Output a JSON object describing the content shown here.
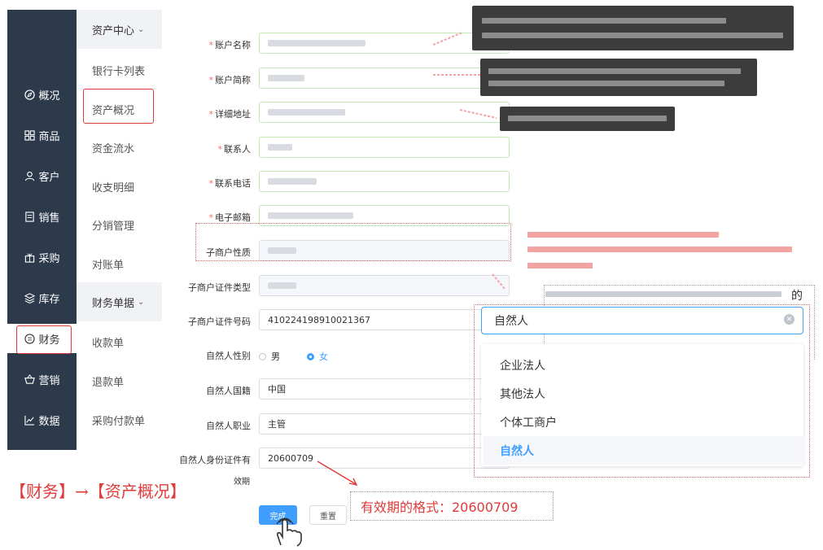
{
  "nav": {
    "items": [
      {
        "label": "概况",
        "icon": "compass-icon"
      },
      {
        "label": "商品",
        "icon": "grid-icon"
      },
      {
        "label": "客户",
        "icon": "user-icon"
      },
      {
        "label": "销售",
        "icon": "document-icon"
      },
      {
        "label": "采购",
        "icon": "gift-icon"
      },
      {
        "label": "库存",
        "icon": "layers-icon"
      },
      {
        "label": "财务",
        "icon": "finance-icon"
      },
      {
        "label": "营销",
        "icon": "basket-icon"
      },
      {
        "label": "数据",
        "icon": "chart-icon"
      }
    ],
    "active": "财务"
  },
  "subnav": {
    "group1": "资产中心",
    "group1_items": [
      "银行卡列表",
      "资产概况",
      "资金流水",
      "收支明细",
      "分销管理",
      "对账单"
    ],
    "group2": "财务单据",
    "group2_items": [
      "收款单",
      "退款单",
      "采购付款单"
    ],
    "active": "资产概况"
  },
  "form": {
    "fields": [
      {
        "label": "账户名称",
        "required": true
      },
      {
        "label": "账户简称",
        "required": true
      },
      {
        "label": "详细地址",
        "required": true
      },
      {
        "label": "联系人",
        "required": true
      },
      {
        "label": "联系电话",
        "required": true
      },
      {
        "label": "电子邮箱",
        "required": true
      },
      {
        "label": "子商户性质",
        "required": false
      },
      {
        "label": "子商户证件类型",
        "required": false
      },
      {
        "label": "子商户证件号码",
        "required": false,
        "value": "410224198910021367"
      },
      {
        "label": "自然人性别",
        "required": false
      },
      {
        "label": "自然人国籍",
        "required": false,
        "value": "中国"
      },
      {
        "label": "自然人职业",
        "required": false,
        "value": "主管"
      },
      {
        "label": "自然人身份证件有",
        "required": false,
        "value": "20600709"
      }
    ],
    "validity_suffix": "效期",
    "gender": {
      "male": "男",
      "female": "女",
      "selected": "女"
    },
    "submit_label": "完成",
    "reset_label": "重置"
  },
  "dropdown": {
    "input_value": "自然人",
    "options": [
      "企业法人",
      "其他法人",
      "个体工商户",
      "自然人"
    ],
    "selected": "自然人"
  },
  "annotations": {
    "breadcrumb_note": "【财务】→【资产概况】",
    "date_format_note": "有效期的格式：20600709",
    "blurred_trailing_char": "的"
  },
  "colors": {
    "nav_bg": "#2d3a4b",
    "accent": "#409eff",
    "annotation_red": "#e03b3b"
  }
}
